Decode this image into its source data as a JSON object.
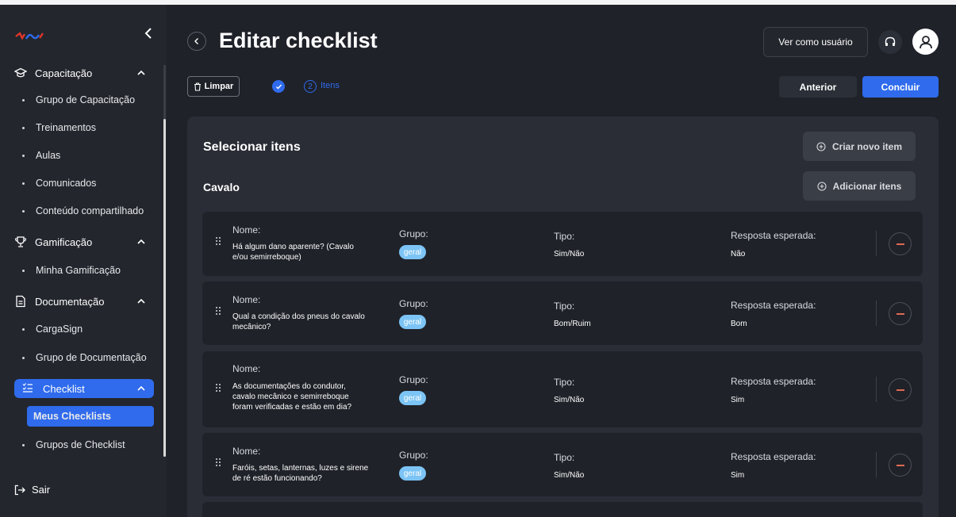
{
  "sidebar": {
    "sections": [
      {
        "label": "Capacitação",
        "items": [
          "Grupo de Capacitação",
          "Treinamentos",
          "Aulas",
          "Comunicados",
          "Conteúdo compartilhado"
        ]
      },
      {
        "label": "Gamificação",
        "items": [
          "Minha Gamificação"
        ]
      },
      {
        "label": "Documentação",
        "items": [
          "CargaSign",
          "Grupo de Documentação"
        ]
      },
      {
        "label": "Checklist",
        "items": [
          "Meus Checklists",
          "Grupos de Checklist"
        ]
      }
    ],
    "logout_label": "Sair"
  },
  "header": {
    "title": "Editar checklist",
    "view_as_user_label": "Ver como usuário"
  },
  "toolbar": {
    "clear_label": "Limpar",
    "step2_number": "2",
    "step2_label": "Itens",
    "previous_label": "Anterior",
    "finish_label": "Concluir"
  },
  "panel": {
    "title": "Selecionar itens",
    "create_item_label": "Criar novo item",
    "group_name": "Cavalo",
    "add_items_label": "Adicionar itens",
    "field_labels": {
      "name": "Nome:",
      "group": "Grupo:",
      "type": "Tipo:",
      "expected": "Resposta esperada:"
    },
    "items": [
      {
        "name_lines": [
          "Há algum dano aparente? (Cavalo",
          "e/ou semirreboque)"
        ],
        "group": "geral",
        "type": "Sim/Não",
        "expected": "Não"
      },
      {
        "name_lines": [
          "Qual a condição dos pneus do cavalo",
          "mecânico?"
        ],
        "group": "geral",
        "type": "Bom/Ruim",
        "expected": "Bom"
      },
      {
        "name_lines": [
          "As documentações do condutor,",
          "cavalo mecânico e semirreboque",
          "foram verificadas e estão em dia?"
        ],
        "group": "geral",
        "type": "Sim/Não",
        "expected": "Sim"
      },
      {
        "name_lines": [
          "Faróis, setas, lanternas, luzes e sirene",
          "de ré estão funcionando?"
        ],
        "group": "geral",
        "type": "Sim/Não",
        "expected": "Sim"
      },
      {
        "name_lines": [],
        "group": "",
        "type": "",
        "expected": ""
      }
    ]
  },
  "colors": {
    "accent": "#2f6bec",
    "background": "#1f2229",
    "panel": "#2a2d35",
    "tag": "#7cc4f5",
    "remove": "#e06a52"
  }
}
